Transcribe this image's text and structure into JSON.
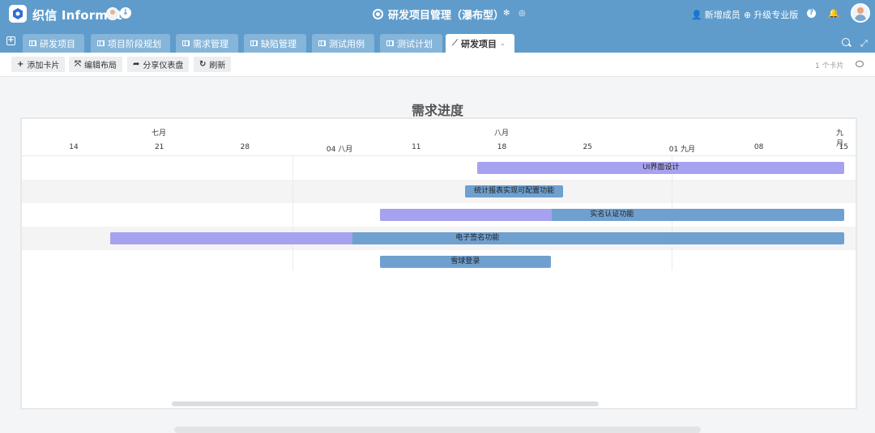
{
  "header": {
    "brand": "织信 Informat",
    "title": "研发项目管理（瀑布型）",
    "add_member": "新增成员",
    "upgrade": "升级专业版",
    "help": "?"
  },
  "tabs": [
    {
      "label": "研发项目",
      "active": false
    },
    {
      "label": "项目阶段规划",
      "active": false
    },
    {
      "label": "需求管理",
      "active": false
    },
    {
      "label": "缺陷管理",
      "active": false
    },
    {
      "label": "测试用例",
      "active": false
    },
    {
      "label": "测试计划",
      "active": false
    },
    {
      "label": "研发项目",
      "active": true
    }
  ],
  "toolbar": {
    "add_card": "添加卡片",
    "edit_layout": "编辑布局",
    "share_dashboard": "分享仪表盘",
    "refresh": "刷新",
    "card_count": "1 个卡片"
  },
  "chart_data": {
    "type": "gantt",
    "title": "需求进度",
    "months": [
      "七月",
      "八月",
      "九月"
    ],
    "ticks": [
      "14",
      "21",
      "28",
      "04 八月",
      "11",
      "18",
      "25",
      "01 九月",
      "08",
      "15"
    ],
    "tasks": [
      {
        "name": "UI界面设计",
        "start": "08-16",
        "end": "09-15",
        "progress": 0
      },
      {
        "name": "统计报表实现可配置功能",
        "start": "08-15",
        "end": "08-23",
        "progress": 0
      },
      {
        "name": "实名认证功能",
        "start": "08-08",
        "end": "09-15",
        "progress": 0.37
      },
      {
        "name": "电子签名功能",
        "start": "07-17",
        "end": "09-15",
        "progress": 0.33
      },
      {
        "name": "雪球登录",
        "start": "08-08",
        "end": "08-22",
        "progress": 0
      }
    ]
  },
  "colors": {
    "header_bg": "#5f9ccc",
    "bar_fill": "#6fa0cf",
    "bar_progress": "#a7a2ef"
  }
}
